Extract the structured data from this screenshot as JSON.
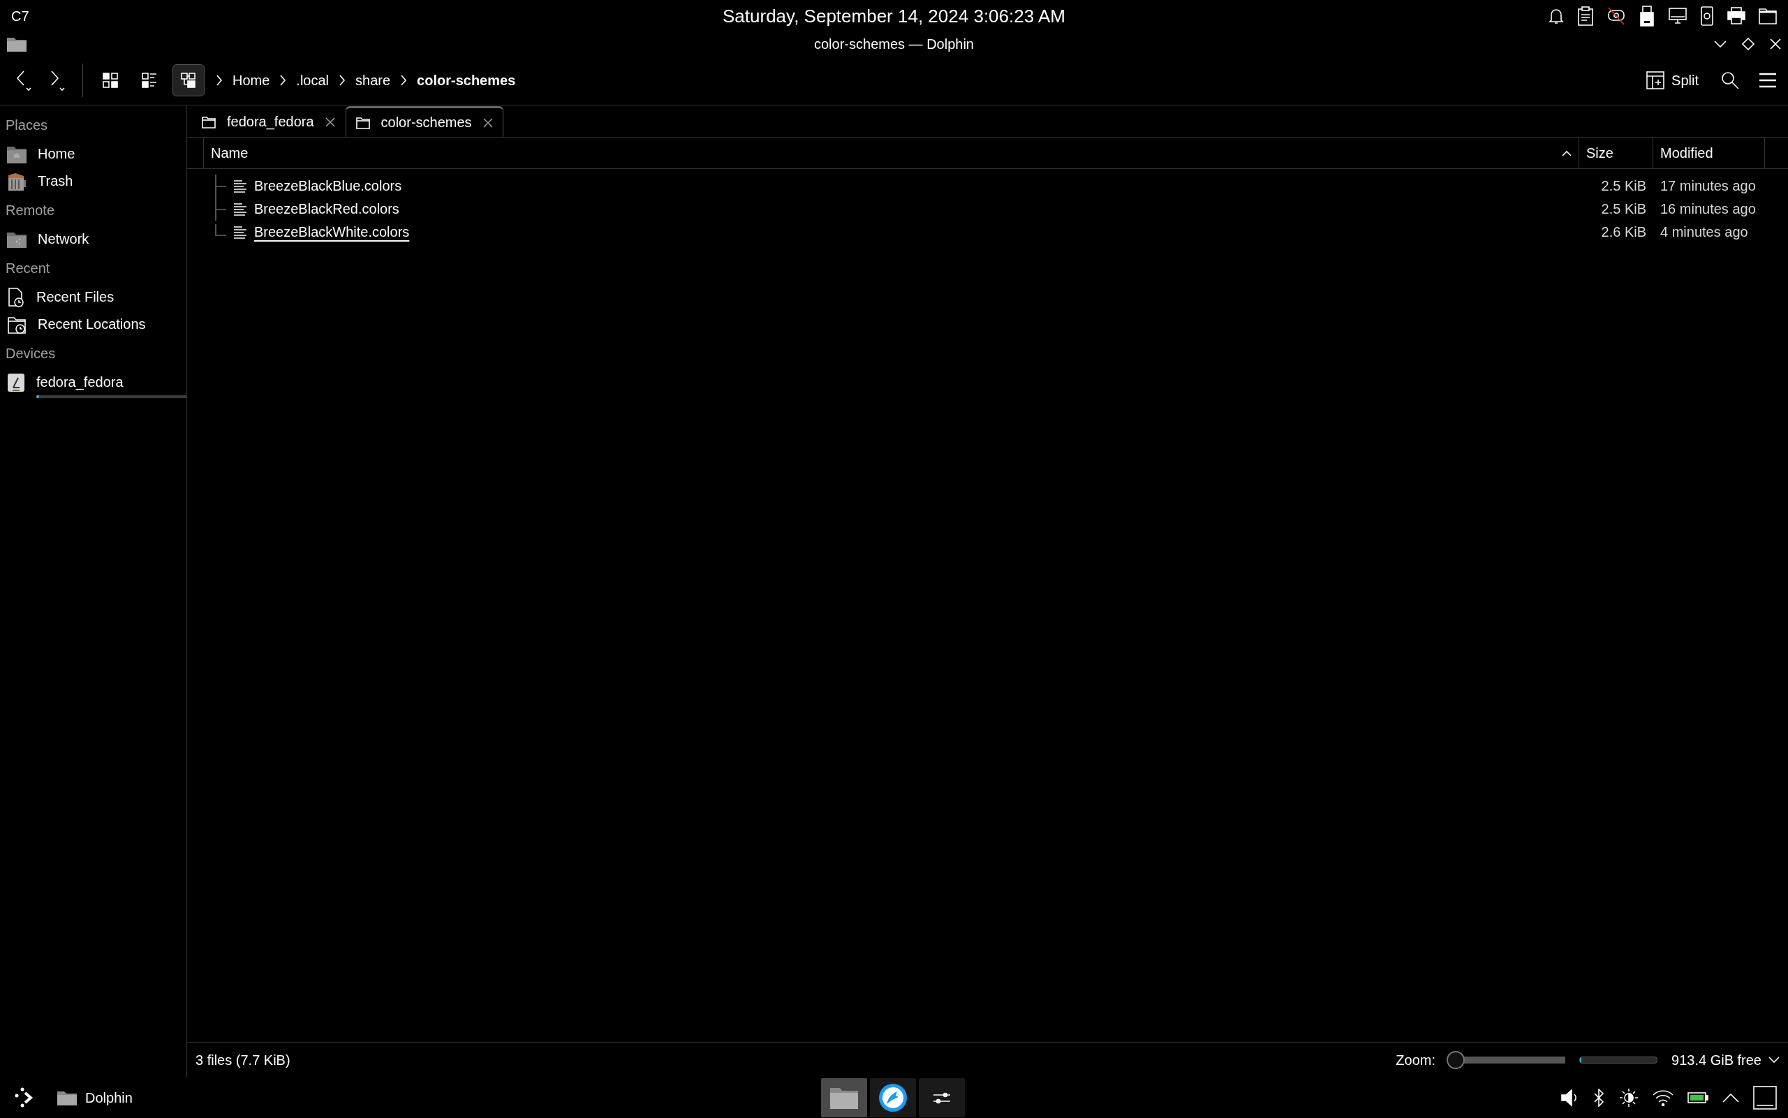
{
  "top_panel": {
    "workspace": "C7",
    "clock": "Saturday, September 14, 2024 3:06:23 AM"
  },
  "window": {
    "title": "color-schemes — Dolphin"
  },
  "toolbar": {
    "view_modes": [
      {
        "kind": "icons",
        "selected": false
      },
      {
        "kind": "compact",
        "selected": false
      },
      {
        "kind": "details",
        "selected": true
      }
    ],
    "breadcrumb": [
      {
        "label": "Home",
        "current": false
      },
      {
        "label": ".local",
        "current": false
      },
      {
        "label": "share",
        "current": false
      },
      {
        "label": "color-schemes",
        "current": true
      }
    ],
    "split_button": "Split"
  },
  "sidebar": {
    "sections": [
      {
        "title": "Places",
        "items": [
          {
            "label": "Home",
            "kind": "home"
          },
          {
            "label": "Trash",
            "kind": "trash"
          }
        ]
      },
      {
        "title": "Remote",
        "items": [
          {
            "label": "Network",
            "kind": "network"
          }
        ]
      },
      {
        "title": "Recent",
        "items": [
          {
            "label": "Recent Files",
            "kind": "recent-files"
          },
          {
            "label": "Recent Locations",
            "kind": "recent-locations"
          }
        ]
      },
      {
        "title": "Devices",
        "items": [
          {
            "label": "fedora_fedora",
            "kind": "drive",
            "level": 0.02
          }
        ]
      }
    ]
  },
  "tabs": [
    {
      "label": "fedora_fedora",
      "selected": false
    },
    {
      "label": "color-schemes",
      "selected": true
    }
  ],
  "table": {
    "columns": [
      {
        "label": "Name",
        "sorted": true
      },
      {
        "label": "Size",
        "sorted": false
      },
      {
        "label": "Modified",
        "sorted": false
      }
    ],
    "rows": [
      {
        "name": "BreezeBlackBlue.colors",
        "size": "2.5 KiB",
        "modified": "17 minutes ago",
        "hovered": false
      },
      {
        "name": "BreezeBlackRed.colors",
        "size": "2.5 KiB",
        "modified": "16 minutes ago",
        "hovered": false
      },
      {
        "name": "BreezeBlackWhite.colors",
        "size": "2.6 KiB",
        "modified": "4 minutes ago",
        "hovered": true
      }
    ]
  },
  "status_bar": {
    "summary": "3 files (7.7 KiB)",
    "zoom_label": "Zoom:",
    "zoom": {
      "level": 0
    },
    "free_space": {
      "level": 0.02
    },
    "free_label": "913.4 GiB free"
  },
  "taskbar": {
    "task": "Dolphin",
    "pinned": [
      {
        "kind": "files",
        "selected": true
      },
      {
        "kind": "browser",
        "selected": false
      },
      {
        "kind": "settings",
        "selected": false
      }
    ]
  }
}
